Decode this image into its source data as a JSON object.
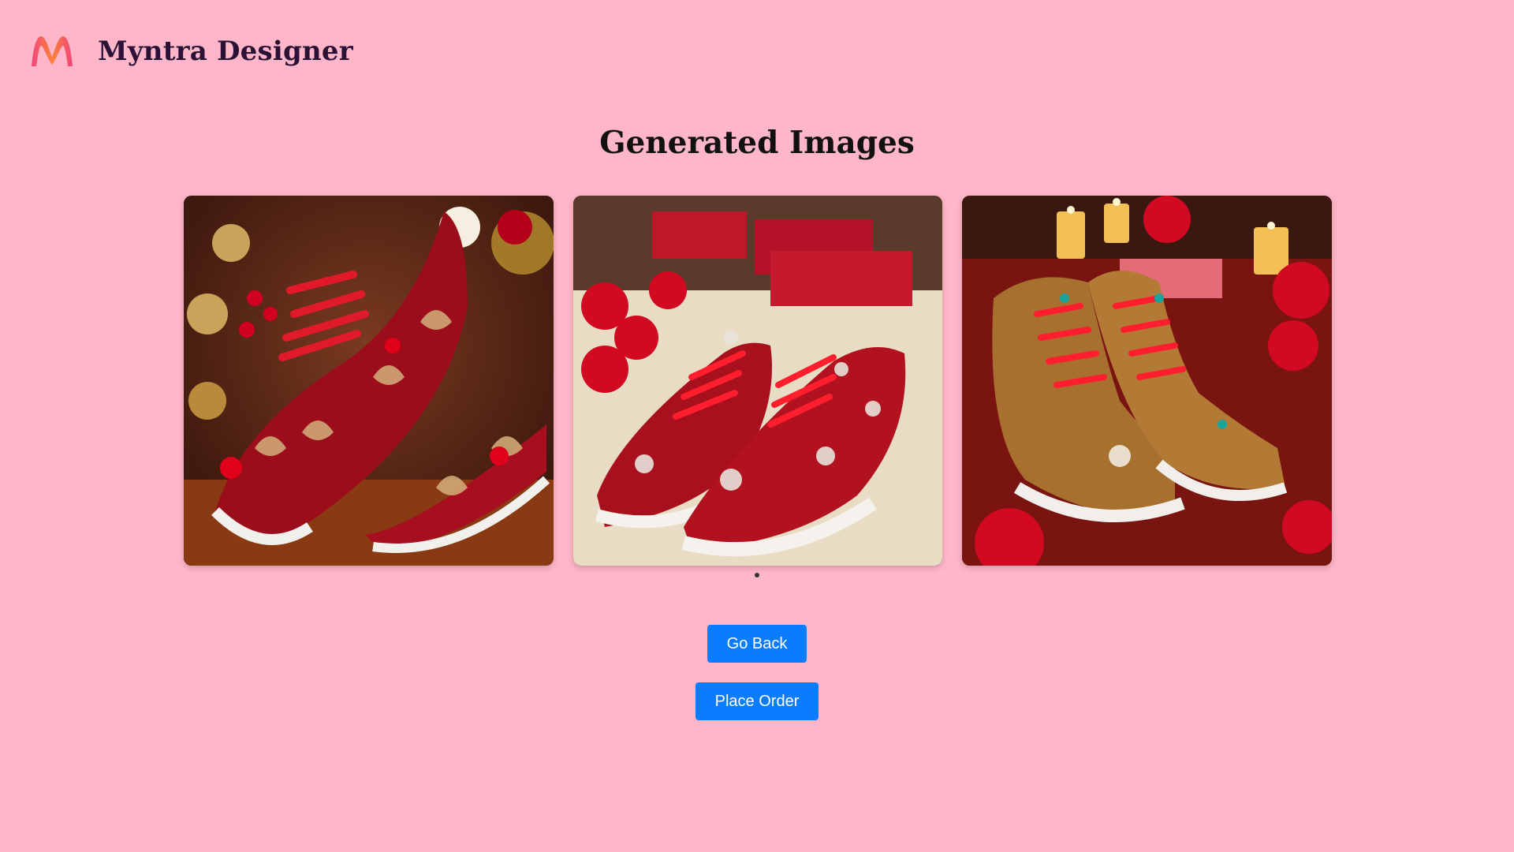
{
  "header": {
    "logo_icon": "myntra-logo",
    "title": "Myntra Designer"
  },
  "main": {
    "title": "Generated Images",
    "images": [
      {
        "icon": "embroidered-red-sneakers-image"
      },
      {
        "icon": "embellished-red-sneakers-image"
      },
      {
        "icon": "red-gold-high-top-sneakers-image"
      }
    ],
    "carousel": {
      "dots": 1,
      "active": 1
    }
  },
  "actions": {
    "go_back_label": "Go Back",
    "place_order_label": "Place Order"
  },
  "colors": {
    "background": "#FFB6C9",
    "button": "#0A7CFF",
    "title": "#2a1236",
    "logo_pink": "#F2447D",
    "logo_orange": "#F9833A"
  }
}
